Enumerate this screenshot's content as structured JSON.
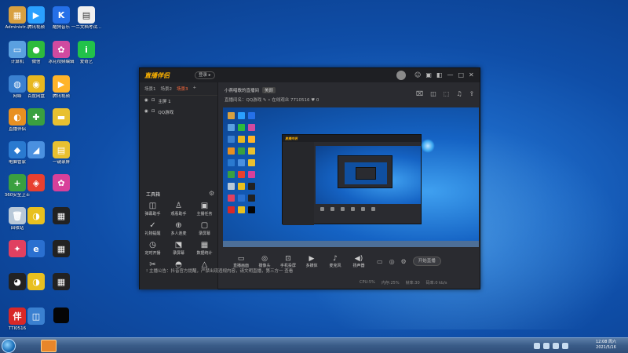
{
  "desktop": {
    "icons": [
      {
        "label": "Administr...",
        "color": "#d8a040",
        "glyph": "▦"
      },
      {
        "label": "腾讯视频",
        "color": "#2aa0ff",
        "glyph": "▶"
      },
      {
        "label": "酷狗音乐",
        "color": "#2570e8",
        "glyph": "K"
      },
      {
        "label": "一二文档考试...",
        "color": "#f0f0f0",
        "glyph": "▤"
      },
      {
        "label": "计算机",
        "color": "#5aa0e0",
        "glyph": "▭"
      },
      {
        "label": "微信",
        "color": "#2dbb3c",
        "glyph": "●"
      },
      {
        "label": "冰花视频编辑",
        "color": "#d04aa0",
        "glyph": "✿"
      },
      {
        "label": "爱奇艺",
        "color": "#22c24a",
        "glyph": "i"
      },
      {
        "label": "网络",
        "color": "#3a80d0",
        "glyph": "◍"
      },
      {
        "label": "百度网盘",
        "color": "#e8b820",
        "glyph": "◉"
      },
      {
        "label": "腾讯视频",
        "color": "#ffb42a",
        "glyph": "▶"
      },
      {
        "label": "回收站",
        "color": "#b8c8d8",
        "glyph": "🗑"
      },
      {
        "label": "360安全卫士",
        "color": "#3aa040",
        "glyph": "+"
      },
      {
        "label": "一键录屏",
        "color": "#e8c030",
        "glyph": "▤"
      },
      {
        "label": "直播伴侣",
        "color": "#e89020",
        "glyph": "◐"
      },
      {
        "label": "电脑管家",
        "color": "#2a7ad0",
        "glyph": "◆"
      },
      {
        "label": "TTI0516",
        "color": "#d82828",
        "glyph": "伴"
      },
      {
        "label": "",
        "color": "#101010",
        "glyph": ""
      }
    ]
  },
  "taskbar": {
    "time": "12:08 周六",
    "date": "2021/5/16"
  },
  "app": {
    "logo": "直播伴侣",
    "login_label": "登录 ▸",
    "title_icons": [
      "☺",
      "▣",
      "◧",
      "—",
      "□",
      "✕"
    ],
    "scene_tabs": [
      "场景1",
      "场景2",
      "场景3",
      "+"
    ],
    "active_tab": "场景3",
    "sources": [
      {
        "label": "主屏 1"
      },
      {
        "label": "QQ游戏"
      }
    ],
    "tools_title": "工具箱",
    "tools": [
      {
        "icon": "◫",
        "label": "弹幕助手"
      },
      {
        "icon": "♙",
        "label": "观看助手"
      },
      {
        "icon": "▣",
        "label": "主播任务"
      },
      {
        "icon": "✓",
        "label": "礼物提醒"
      },
      {
        "icon": "⊕",
        "label": "多人连麦"
      },
      {
        "icon": "▢",
        "label": "录屏幕"
      },
      {
        "icon": "◷",
        "label": "定时开播"
      },
      {
        "icon": "⬔",
        "label": "录屏幕"
      },
      {
        "icon": "▦",
        "label": "数据统计"
      },
      {
        "icon": "✂",
        "label": ""
      },
      {
        "icon": "◓",
        "label": ""
      },
      {
        "icon": "△",
        "label": ""
      }
    ],
    "notice": "! 主播公告：抖音官方提醒，严禁出现违规内容，请文明直播，第三方一 查看",
    "top_info": "小燕唱歌的直播间",
    "top_tag": "美颜",
    "room_line": "直播间名：QQ游戏 ✎    • 在线观众    7710516    ♥ 0",
    "right_icons": [
      "⌧",
      "◫",
      "⬚",
      "♫",
      "⇪"
    ],
    "controls": [
      {
        "icon": "▭",
        "label": "直播画面"
      },
      {
        "icon": "◎",
        "label": "摄像头"
      },
      {
        "icon": "⊡",
        "label": "手机投屏"
      },
      {
        "icon": "▶",
        "label": "多媒体"
      },
      {
        "icon": "♪",
        "label": "麦克风"
      },
      {
        "icon": "◀)",
        "label": "扬声器"
      }
    ],
    "side_controls": [
      "▭",
      "◎",
      "⚙"
    ],
    "start_label": "开始直播",
    "status": [
      "CPU:5%",
      "内存:25%",
      "帧率:30",
      "码率:0 kb/s"
    ]
  }
}
